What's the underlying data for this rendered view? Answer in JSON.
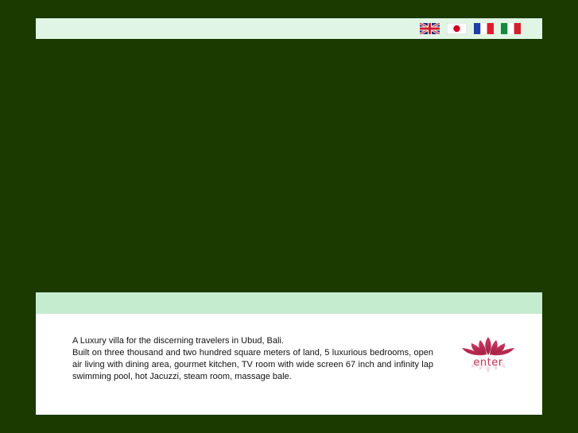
{
  "header": {
    "languages": [
      {
        "name": "English",
        "icon": "uk-flag-icon"
      },
      {
        "name": "Japanese",
        "icon": "japan-flag-icon"
      },
      {
        "name": "French",
        "icon": "france-flag-icon"
      },
      {
        "name": "Italian",
        "icon": "italy-flag-icon"
      }
    ]
  },
  "intro": {
    "line1": "A Luxury villa for the discerning travelers in Ubud, Bali.",
    "line2": "Built on three thousand and two hundred square meters of land, 5 luxurious bedrooms, open air living with dining area, gourmet kitchen, TV room with wide screen 67 inch and infinity lap swimming pool, hot Jacuzzi, steam room, massage bale."
  },
  "enter": {
    "label": "enter",
    "icon": "lotus-icon"
  },
  "colors": {
    "background": "#1a3a00",
    "top_bar": "#e0f5e3",
    "strip": "#c6ecd0",
    "panel": "#ffffff",
    "accent": "#c0385a"
  }
}
